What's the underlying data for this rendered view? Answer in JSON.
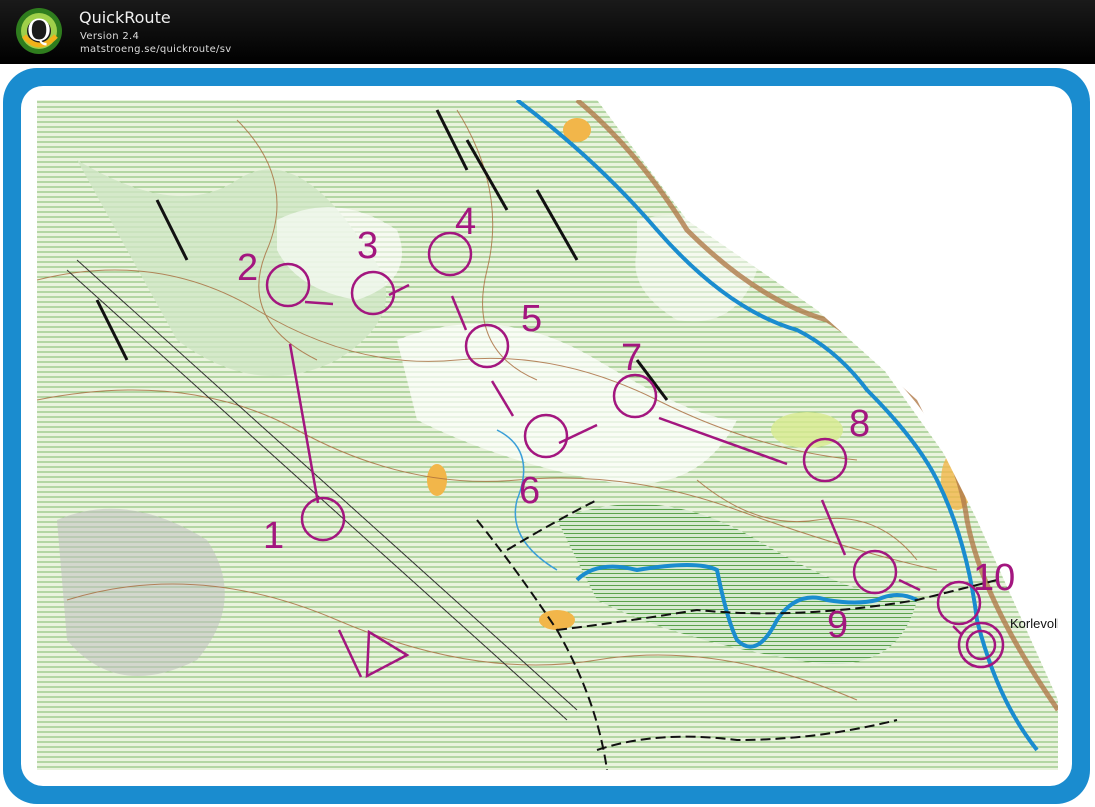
{
  "app": {
    "title": "QuickRoute",
    "version": "Version 2.4",
    "url": "matstroeng.se/quickroute/sv",
    "logo_letter": "Q"
  },
  "map": {
    "place_name": "Korlevoll",
    "course_color": "#a3167f",
    "frame_color": "#1a8ccf",
    "controls": [
      "1",
      "2",
      "3",
      "4",
      "5",
      "6",
      "7",
      "8",
      "9",
      "10"
    ]
  }
}
